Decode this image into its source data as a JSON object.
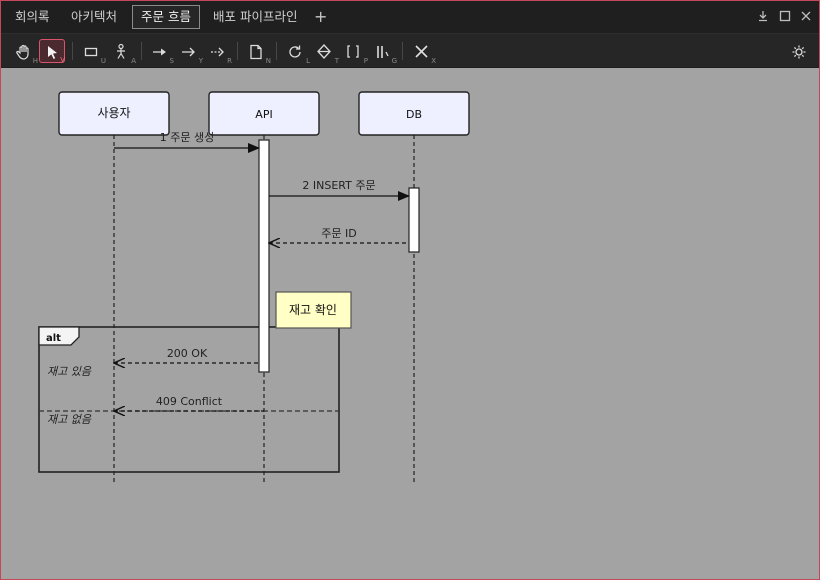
{
  "tabs": [
    {
      "label": "회의록",
      "active": false
    },
    {
      "label": "아키텍처",
      "active": false
    },
    {
      "label": "주문 흐름",
      "active": true
    },
    {
      "label": "배포 파이프라인",
      "active": false
    }
  ],
  "tab_add": "+",
  "window_buttons": {
    "download": "download-icon",
    "maximize": "maximize-icon",
    "close": "close-icon"
  },
  "toolbar": {
    "tools": [
      {
        "icon": "hand-icon",
        "key": "H"
      },
      {
        "icon": "pointer-icon",
        "key": "V",
        "selected": true
      },
      {
        "icon": "rectangle-icon",
        "key": "U"
      },
      {
        "icon": "actor-icon",
        "key": "A"
      },
      {
        "icon": "sync-message-icon",
        "key": "S"
      },
      {
        "icon": "async-message-icon",
        "key": "Y"
      },
      {
        "icon": "return-message-icon",
        "key": "R"
      },
      {
        "icon": "note-icon",
        "key": "N"
      },
      {
        "icon": "loop-icon",
        "key": "L"
      },
      {
        "icon": "alt-icon",
        "key": "T"
      },
      {
        "icon": "opt-icon",
        "key": "P"
      },
      {
        "icon": "par-icon",
        "key": "G"
      },
      {
        "icon": "delete-icon",
        "key": "X"
      }
    ],
    "settings_icon": "gear-icon"
  },
  "diagram": {
    "participants": [
      "사용자",
      "API",
      "DB"
    ],
    "messages": [
      {
        "label": "1 주문 생성",
        "type": "sync"
      },
      {
        "label": "2 INSERT 주문",
        "type": "sync"
      },
      {
        "label": "주문 ID",
        "type": "return"
      },
      {
        "label": "200 OK",
        "type": "return"
      },
      {
        "label": "409 Conflict",
        "type": "return"
      }
    ],
    "note": "재고 확인",
    "fragment": {
      "operator": "alt",
      "conditions": [
        "재고 있음",
        "재고 없음"
      ]
    }
  },
  "colors": {
    "accent": "#d9546a",
    "participant_fill": "#eef0ff",
    "note_fill": "#ffffc6",
    "canvas": "#a3a3a3"
  }
}
